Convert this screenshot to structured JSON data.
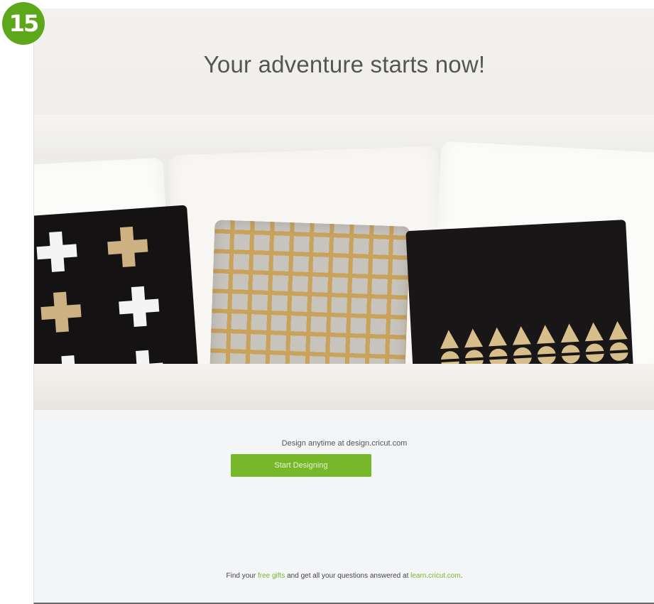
{
  "step_badge": "15",
  "hero": {
    "title": "Your adventure starts now!"
  },
  "cta": {
    "design_text": "Design anytime at design.cricut.com",
    "button_label": "Start Designing"
  },
  "footer": {
    "prefix": "Find your ",
    "link_gifts": "free gifts",
    "middle": " and get all your questions answered at ",
    "link_learn": "learn.cricut.com",
    "suffix": "."
  },
  "colors": {
    "accent_green": "#76b82a",
    "badge_green": "#5da71a"
  }
}
